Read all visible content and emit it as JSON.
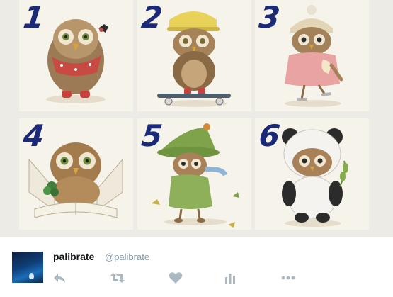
{
  "media": {
    "tiles": [
      {
        "number": "1",
        "icon": "owl-with-bandana"
      },
      {
        "number": "2",
        "icon": "owl-on-skateboard"
      },
      {
        "number": "3",
        "icon": "owl-in-pink-coat"
      },
      {
        "number": "4",
        "icon": "owl-reading-book"
      },
      {
        "number": "5",
        "icon": "owl-in-green-hat"
      },
      {
        "number": "6",
        "icon": "owl-in-panda-suit"
      }
    ],
    "colors": {
      "numbers": "#1b2a78",
      "tile_background": "#f6f3ea"
    }
  },
  "tweet": {
    "author_name": "palibrate",
    "author_handle": "@palibrate",
    "actions": [
      {
        "icon": "reply-icon"
      },
      {
        "icon": "retweet-icon"
      },
      {
        "icon": "like-heart-icon"
      },
      {
        "icon": "analytics-icon"
      },
      {
        "icon": "more-options-icon"
      }
    ],
    "colors": {
      "name": "#14171a",
      "handle": "#8899a6",
      "action_icons": "#aab8c2"
    }
  }
}
